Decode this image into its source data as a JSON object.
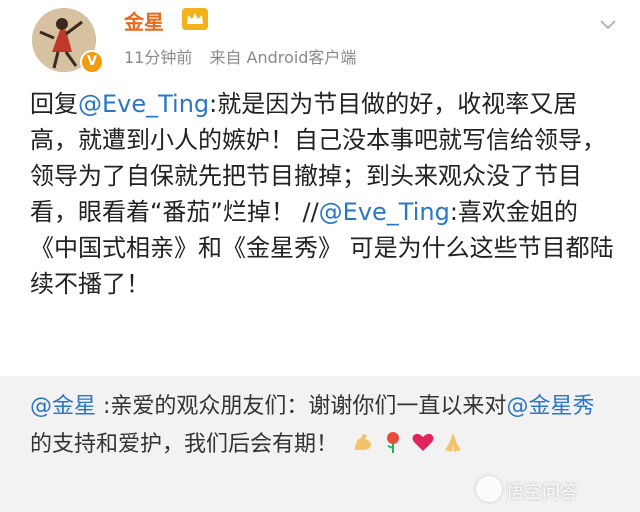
{
  "post": {
    "username": "金星",
    "time": "11分钟前",
    "source": "来自 Android客户端",
    "badge": "V",
    "content": {
      "reply_prefix": "回复",
      "mention1": "@Eve_Ting",
      "text1": ":就是因为节目做的好，收视率又居高，就遭到小人的嫉妒！自己没本事吧就写信给领导，领导为了自保就先把节目撤掉；到头来观众没了节目看，眼看着“番茄”烂掉！ //",
      "mention2": "@Eve_Ting",
      "text2": ":喜欢金姐的《中国式相亲》和《金星秀》 可是为什么这些节目都陆续不播了！"
    }
  },
  "repost": {
    "mention1": "@金星",
    "text1": " :亲爱的观众朋友们：谢谢你们一直以来对",
    "mention2": "@金星秀",
    "text2": " 的支持和爱护，我们后会有期！"
  },
  "icons": {
    "avatar": "avatar-dancer",
    "crown": "crown-icon",
    "chevron": "chevron-down-icon",
    "emojis": [
      "flexed-arm-icon",
      "rose-icon",
      "heart-icon",
      "praying-hands-icon"
    ]
  },
  "watermark": "悟空问答",
  "colors": {
    "mention": "#2a77c8",
    "username": "#e86a1f"
  }
}
